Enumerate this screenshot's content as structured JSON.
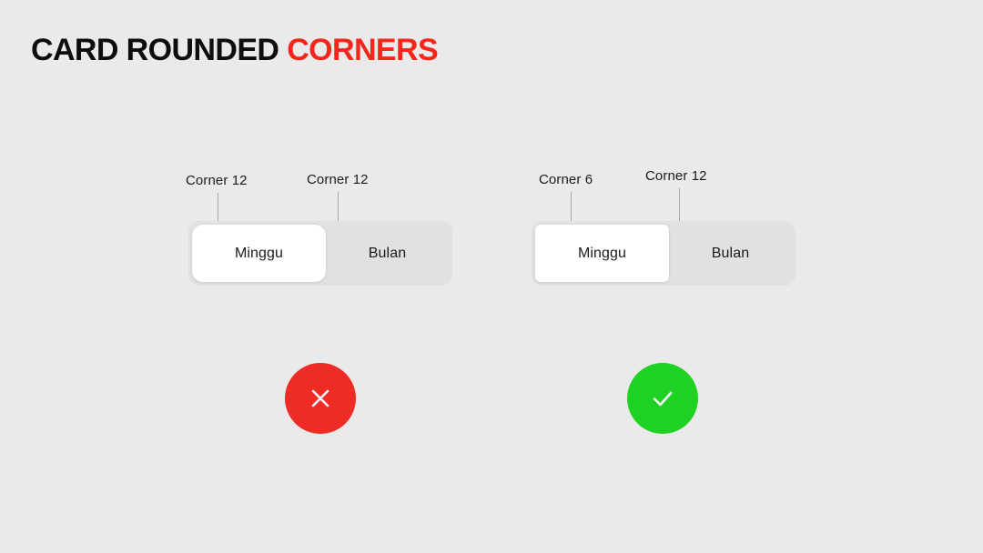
{
  "title": {
    "main": "CARD ROUNDED",
    "accent": "CORNERS",
    "main_color": "#0D0D0D",
    "accent_color": "#F5271D"
  },
  "background_color": "#EAEAEA",
  "examples": [
    {
      "id": "incorrect",
      "verdict": "cross-icon",
      "verdict_color": "#EE2B24",
      "container": {
        "fill": "#E1E1E1",
        "corner_radius": 12,
        "callout_label": "Corner 12"
      },
      "selected_card": {
        "fill": "#FFFFFF",
        "corner_radius": 12,
        "callout_label": "Corner 12",
        "label": "Minggu"
      },
      "unselected_label": "Bulan"
    },
    {
      "id": "correct",
      "verdict": "check-icon",
      "verdict_color": "#1ED122",
      "container": {
        "fill": "#E1E1E1",
        "corner_radius": 12,
        "callout_label": "Corner 12"
      },
      "selected_card": {
        "fill": "#FFFFFF",
        "corner_radius": 6,
        "callout_label": "Corner 6",
        "label": "Minggu"
      },
      "unselected_label": "Bulan"
    }
  ]
}
